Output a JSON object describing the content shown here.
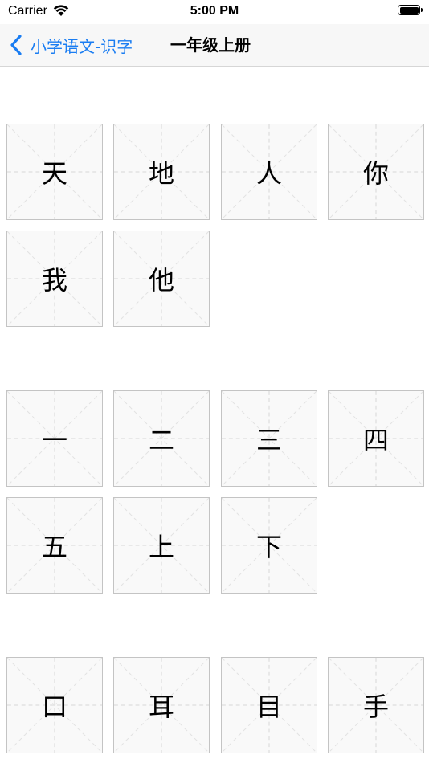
{
  "status_bar": {
    "carrier": "Carrier",
    "time": "5:00 PM",
    "wifi_icon": "wifi-icon",
    "battery_icon": "battery-icon"
  },
  "nav": {
    "back_label": "小学语文-识字",
    "back_icon": "chevron-left-icon",
    "title": "一年级上册",
    "accent_color": "#1a7df2"
  },
  "groups": [
    {
      "characters": [
        "天",
        "地",
        "人",
        "你",
        "我",
        "他"
      ]
    },
    {
      "characters": [
        "一",
        "二",
        "三",
        "四",
        "五",
        "上",
        "下"
      ]
    },
    {
      "characters": [
        "口",
        "耳",
        "目",
        "手"
      ]
    }
  ]
}
